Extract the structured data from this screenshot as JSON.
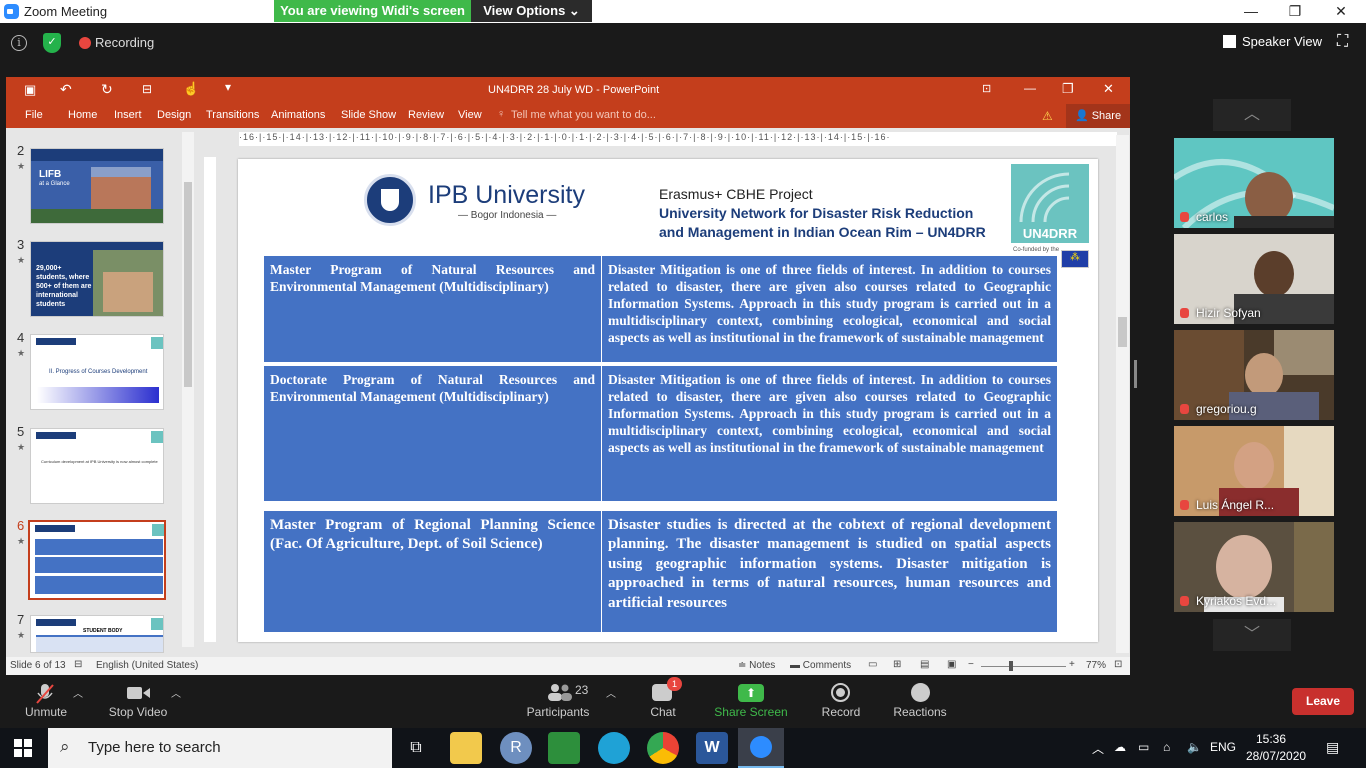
{
  "window": {
    "title": "Zoom Meeting",
    "banner": "You are viewing Widi's screen",
    "view_options": "View Options ⌄",
    "minimize": "—",
    "maximize": "❐",
    "close": "✕"
  },
  "topbar": {
    "recording": "Recording",
    "speaker_view": "Speaker View"
  },
  "ppt": {
    "title": "UN4DRR 28 July WD - PowerPoint",
    "tabs": [
      "File",
      "Home",
      "Insert",
      "Design",
      "Transitions",
      "Animations",
      "Slide Show",
      "Review",
      "View"
    ],
    "tell_me": "Tell me what you want to do...",
    "share": "Share",
    "ruler": "·16·|·15·|·14·|·13·|·12·|·11·|·10·|·9·|·8·|·7·|·6·|·5·|·4·|·3·|·2·|·1·|·0·|·1·|·2·|·3·|·4·|·5·|·6·|·7·|·8·|·9·|·10·|·11·|·12·|·13·|·14·|·15·|·16·",
    "thumbs": [
      {
        "num": "2",
        "label": "LIFB",
        "sub": "at a Glance"
      },
      {
        "num": "3",
        "label": "29,000+ students, where 500+ of them are international students"
      },
      {
        "num": "4",
        "label": "II. Progress of Courses Development"
      },
      {
        "num": "5",
        "label": "Curriculum development at IPB University is now almost complete"
      },
      {
        "num": "6",
        "label": ""
      },
      {
        "num": "7",
        "label": "STUDENT BODY"
      }
    ],
    "status": {
      "slide": "Slide 6 of 13",
      "lang": "English (United States)",
      "notes": "Notes",
      "comments": "Comments",
      "zoom": "77%"
    }
  },
  "slide": {
    "univ": "IPB University",
    "univ_sub": "— Bogor Indonesia —",
    "project_1": "Erasmus+ CBHE Project",
    "project_2": "University Network for Disaster Risk Reduction",
    "project_3": "and Management in Indian Ocean Rim – UN4DRR",
    "logo_text": "UN4DRR",
    "eu_text": "Co-funded by the",
    "rows": [
      {
        "program": "Master Program of Natural Resources and Environmental Management (Multidisciplinary)",
        "desc": "Disaster Mitigation is one of three fields of interest. In addition to courses related to disaster, there are given also courses related to Geographic Information Systems. Approach in this study program is carried out in a multidisciplinary context, combining ecological, economical and social aspects as well as institutional in the framework of sustainable management"
      },
      {
        "program": "Doctorate Program of Natural Resources and Environmental Management (Multidisciplinary)",
        "desc": "Disaster Mitigation is one of three fields of interest. In addition to courses related to disaster, there are given also courses related to Geographic Information Systems. Approach in this study program is carried out in a multidisciplinary context, combining ecological, economical and social aspects as well as institutional in the framework of sustainable management"
      },
      {
        "program": "Master Program of Regional Planning Science (Fac. Of Agriculture, Dept. of Soil Science)",
        "desc": "Disaster studies is directed at the cobtext of regional development planning. The disaster management is studied on spatial aspects using geographic information systems. Disaster mitigation is approached in terms of natural resources, human resources and artificial resources"
      }
    ]
  },
  "participants": [
    {
      "name": "carlos",
      "bg": "#5fc6c2"
    },
    {
      "name": "Hizir Sofyan",
      "bg": "#d8d4cc"
    },
    {
      "name": "gregoriou.g",
      "bg": "#4a3a2a"
    },
    {
      "name": "Luis Ángel R...",
      "bg": "#c79a6a"
    },
    {
      "name": "Kyriakos Evd...",
      "bg": "#5b5040"
    }
  ],
  "toolbar": {
    "unmute": "Unmute",
    "stop_video": "Stop Video",
    "participants": "Participants",
    "participant_count": "23",
    "chat": "Chat",
    "chat_badge": "1",
    "share_screen": "Share Screen",
    "record": "Record",
    "reactions": "Reactions",
    "leave": "Leave"
  },
  "taskbar": {
    "search": "Type here to search",
    "lang": "ENG",
    "time": "15:36",
    "date": "28/07/2020"
  }
}
